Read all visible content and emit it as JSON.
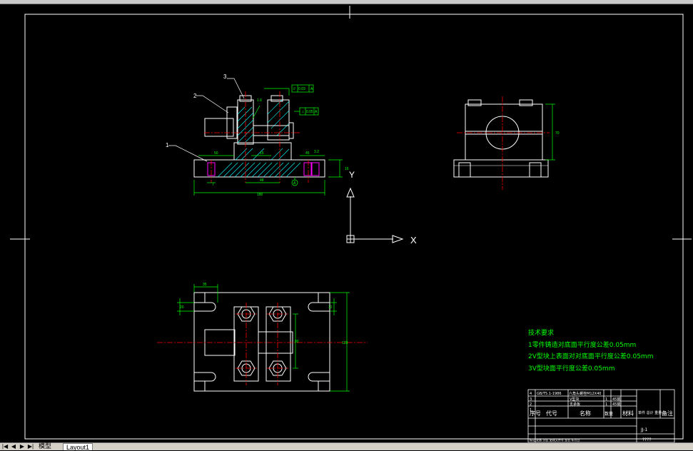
{
  "drawing": {
    "front_view": {
      "leaders": [
        "1",
        "2",
        "3"
      ],
      "dims": [
        "16",
        "50",
        "15",
        "48",
        "45",
        "180",
        "7"
      ],
      "gdt": [
        {
          "symbol": "//",
          "value": "0.03",
          "datum": "A"
        },
        {
          "symbol": "⊥",
          "value": "0.05",
          "datum": "A"
        }
      ],
      "roughness": [
        "1.6",
        "3.2"
      ],
      "datum_label": "A"
    },
    "side_view": {
      "dims": [
        "70"
      ]
    },
    "top_view": {
      "dims": [
        "35",
        "20",
        "12",
        "80",
        "120"
      ]
    },
    "ucs": {
      "x_label": "X",
      "y_label": "Y"
    }
  },
  "tech_requirements": {
    "title": "技术要求",
    "lines": [
      "1零件铸造对底面平行度公差0.05mm",
      "2V型块上表面对对底面平行度公差0.05mm",
      "3V型块面平行度公差0.05mm"
    ]
  },
  "title_block": {
    "rows": [
      {
        "no": "4",
        "code": "GB/T5.1-1986",
        "name": "六角头螺栓M12X40",
        "qty": "",
        "material": ""
      },
      {
        "no": "3",
        "code": "",
        "name": "V型块",
        "qty": "1",
        "material": "45钢"
      },
      {
        "no": "2",
        "code": "",
        "name": "支承板",
        "qty": "1",
        "material": "45钢"
      },
      {
        "no": "1",
        "code": "",
        "name": "",
        "qty": "",
        "material": ""
      }
    ],
    "headers": {
      "no": "序号",
      "code": "代号",
      "name": "名称",
      "qty": "数量",
      "material": "材料",
      "weight": "单件 总计 重量",
      "note": "备注"
    },
    "drawing_no": "JJ-1",
    "bottom_text": "????",
    "sign_row": "标记 处数 分区 更改文件号 签名 年月日"
  },
  "tabs": {
    "model": "模型",
    "layout": "Layout1"
  },
  "colors": {
    "background": "#000000",
    "outline": "#ffffff",
    "dimension": "#00ff00",
    "centerline": "#ff0000",
    "hatch": "#00ffff",
    "text_green": "#00ff00",
    "magenta": "#ff00ff",
    "leader_yellow": "#ffff00"
  }
}
